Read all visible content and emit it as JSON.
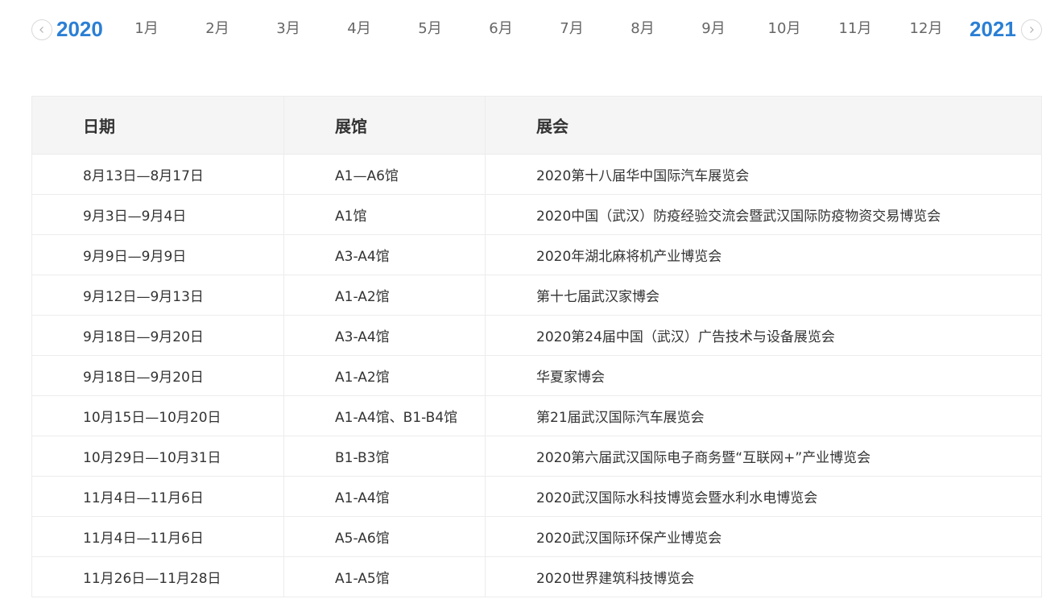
{
  "timeline": {
    "prev_year": "2020",
    "next_year": "2021",
    "months": [
      "1月",
      "2月",
      "3月",
      "4月",
      "5月",
      "6月",
      "7月",
      "8月",
      "9月",
      "10月",
      "11月",
      "12月"
    ],
    "prev_icon": "chevron-left-icon",
    "next_icon": "chevron-right-icon",
    "accent_color": "#2b7fd4"
  },
  "table": {
    "headers": {
      "date": "日期",
      "hall": "展馆",
      "expo": "展会"
    },
    "rows": [
      {
        "date": "8月13日—8月17日",
        "hall": "A1—A6馆",
        "expo": "2020第十八届华中国际汽车展览会"
      },
      {
        "date": "9月3日—9月4日",
        "hall": "A1馆",
        "expo": "2020中国（武汉）防疫经验交流会暨武汉国际防疫物资交易博览会"
      },
      {
        "date": "9月9日—9月9日",
        "hall": "A3-A4馆",
        "expo": "2020年湖北麻将机产业博览会"
      },
      {
        "date": "9月12日—9月13日",
        "hall": "A1-A2馆",
        "expo": "第十七届武汉家博会"
      },
      {
        "date": "9月18日—9月20日",
        "hall": "A3-A4馆",
        "expo": "2020第24届中国（武汉）广告技术与设备展览会"
      },
      {
        "date": "9月18日—9月20日",
        "hall": "A1-A2馆",
        "expo": "华夏家博会"
      },
      {
        "date": "10月15日—10月20日",
        "hall": "A1-A4馆、B1-B4馆",
        "expo": "第21届武汉国际汽车展览会"
      },
      {
        "date": "10月29日—10月31日",
        "hall": "B1-B3馆",
        "expo": "2020第六届武汉国际电子商务暨“互联网+”产业博览会"
      },
      {
        "date": "11月4日—11月6日",
        "hall": "A1-A4馆",
        "expo": "2020武汉国际水科技博览会暨水利水电博览会"
      },
      {
        "date": "11月4日—11月6日",
        "hall": "A5-A6馆",
        "expo": "2020武汉国际环保产业博览会"
      },
      {
        "date": "11月26日—11月28日",
        "hall": "A1-A5馆",
        "expo": "2020世界建筑科技博览会"
      }
    ]
  }
}
